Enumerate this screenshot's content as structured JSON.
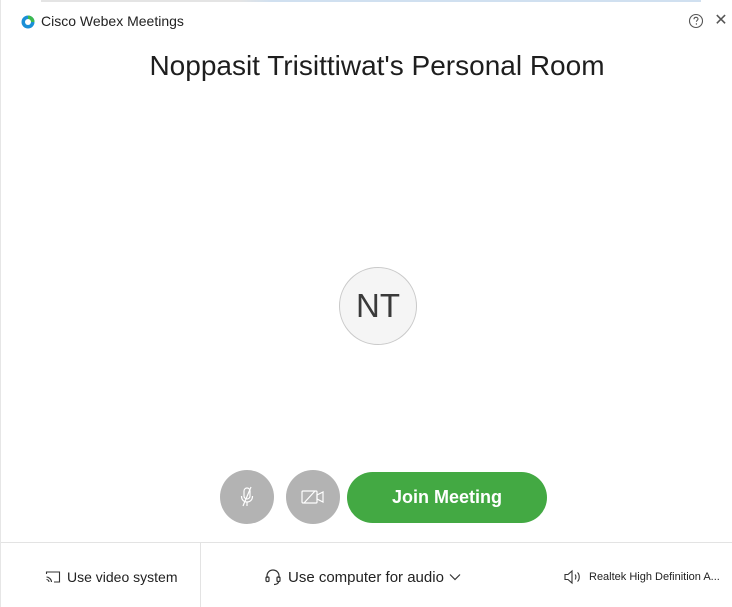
{
  "window": {
    "app_title": "Cisco Webex Meetings",
    "help_icon": "help-circle-icon",
    "close_icon": "close-icon",
    "close_glyph": "✕"
  },
  "meeting": {
    "room_title": "Noppasit Trisittiwat's Personal Room",
    "avatar_initials": "NT"
  },
  "controls": {
    "mute_icon": "microphone-muted-icon",
    "video_icon": "camera-off-icon",
    "join_label": "Join Meeting"
  },
  "bottom_bar": {
    "video_system_label": "Use video system",
    "audio_label": "Use computer for audio",
    "speaker_label": "Realtek High Definition A..."
  },
  "colors": {
    "join_green": "#43a943",
    "disabled_gray": "#b3b3b3",
    "logo_blue": "#1a8fd6",
    "logo_green": "#3dba4e"
  }
}
